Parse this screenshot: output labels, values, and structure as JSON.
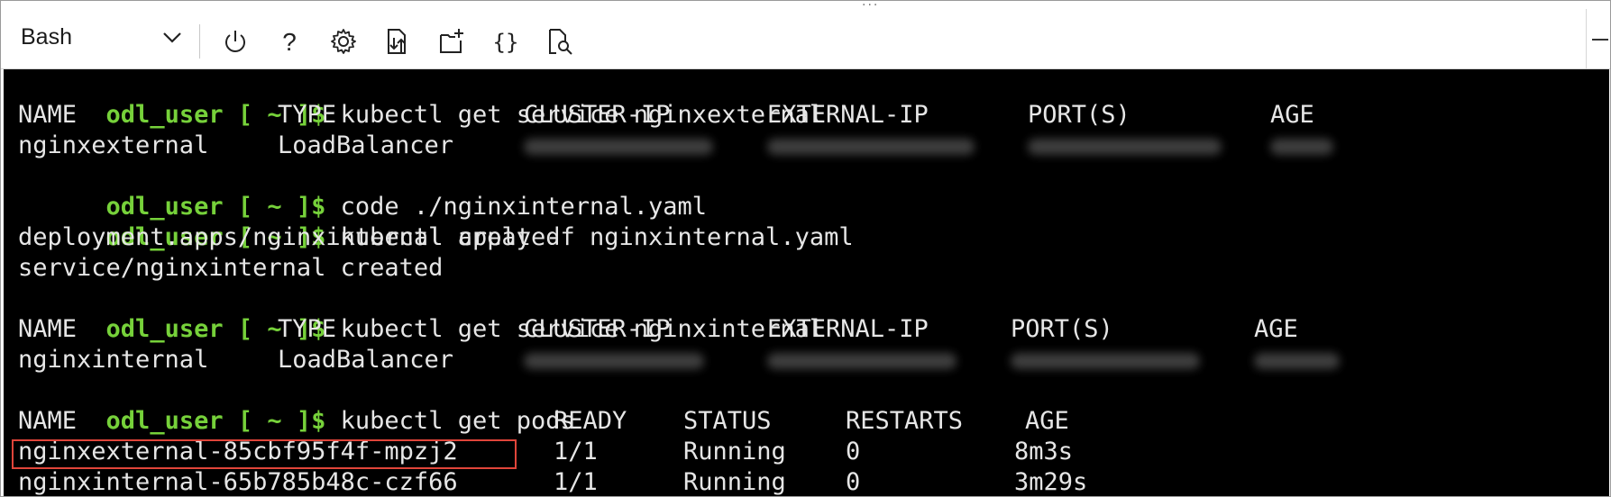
{
  "toolbar": {
    "shell": "Bash",
    "buttons": [
      {
        "name": "power-icon",
        "glyph": "power"
      },
      {
        "name": "help-icon",
        "glyph": "?"
      },
      {
        "name": "settings-icon",
        "glyph": "gear"
      },
      {
        "name": "upload-download-icon",
        "glyph": "file-arrows"
      },
      {
        "name": "new-session-icon",
        "glyph": "new-folder"
      },
      {
        "name": "editor-braces-icon",
        "glyph": "{}"
      },
      {
        "name": "web-preview-icon",
        "glyph": "file-search"
      }
    ],
    "grip": "..."
  },
  "terminal": {
    "prompt": "odl_user [ ~ ]$",
    "colors": {
      "background": "#000000",
      "prompt": "#76d13a",
      "text": "#e6e6e6",
      "highlight": "#e0453a"
    },
    "cmd1": "kubectl get service nginxexternal",
    "svc1_headers": [
      "NAME",
      "TYPE",
      "CLUSTER-IP",
      "EXTERNAL-IP",
      "PORT(S)",
      "AGE"
    ],
    "svc1_row": [
      "nginxexternal",
      "LoadBalancer"
    ],
    "cmd2": "code ./nginxinternal.yaml",
    "cmd3": "kubectl apply -f nginxinternal.yaml",
    "out1": "deployment.apps/nginxinternal created",
    "out2": "service/nginxinternal created",
    "cmd4": "kubectl get service nginxinternal",
    "svc2_headers": [
      "NAME",
      "TYPE",
      "CLUSTER-IP",
      "EXTERNAL-IP",
      "PORT(S)",
      "AGE"
    ],
    "svc2_row": [
      "nginxinternal",
      "LoadBalancer"
    ],
    "cmd5": "kubectl get pods",
    "pods_headers": [
      "NAME",
      "READY",
      "STATUS",
      "RESTARTS",
      "AGE"
    ],
    "pods": [
      [
        "nginxexternal-85cbf95f4f-mpzj2",
        "1/1",
        "Running",
        "0",
        "8m3s"
      ],
      [
        "nginxinternal-65b785b48c-czf66",
        "1/1",
        "Running",
        "0",
        "3m29s"
      ]
    ]
  }
}
